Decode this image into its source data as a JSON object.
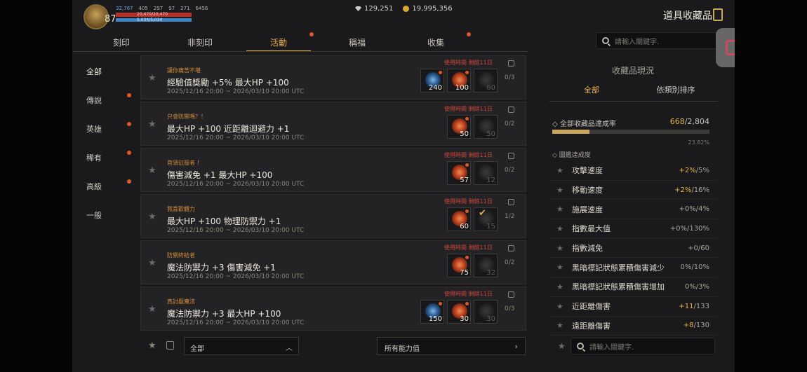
{
  "top": {
    "level": "87",
    "stats": [
      "32,767",
      "405",
      "297",
      "97",
      "271",
      "6456"
    ],
    "hp": "20,470/20,470",
    "mp": "5,034/5,034",
    "currency_gem": "129,251",
    "currency_gold": "19,995,356",
    "page_title": "道具收藏品"
  },
  "tabs": [
    {
      "label": "刻印",
      "active": false,
      "dot": false
    },
    {
      "label": "非刻印",
      "active": false,
      "dot": false
    },
    {
      "label": "活動",
      "active": true,
      "dot": true
    },
    {
      "label": "稱福",
      "active": false,
      "dot": false
    },
    {
      "label": "收集",
      "active": false,
      "dot": true
    }
  ],
  "search": {
    "placeholder": "請輸入關鍵字."
  },
  "categories": [
    {
      "label": "全部",
      "active": true,
      "dot": false
    },
    {
      "label": "傳說",
      "active": false,
      "dot": true
    },
    {
      "label": "英雄",
      "active": false,
      "dot": true
    },
    {
      "label": "稀有",
      "active": false,
      "dot": true
    },
    {
      "label": "高級",
      "active": false,
      "dot": true
    },
    {
      "label": "一般",
      "active": false,
      "dot": false
    }
  ],
  "list": {
    "time_label": "使用時間 剩餘11日",
    "date_range": "2025/12/16 20:00 ~ 2026/03/10 20:00 UTC",
    "rows": [
      {
        "name": "讓你痛苦不堪",
        "effect": "經驗值獎勵 +5% 最大HP +100",
        "count": "0/3",
        "slots": [
          {
            "color": "blue",
            "num": "240",
            "dim": false
          },
          {
            "color": "red",
            "num": "100",
            "dim": false
          },
          {
            "color": "gray",
            "num": "60",
            "dim": true
          }
        ]
      },
      {
        "name": "只會防禦嗎？！",
        "effect": "最大HP +100 近距離迴避力 +1",
        "count": "0/2",
        "slots": [
          {
            "color": "red",
            "num": "50",
            "dim": false
          },
          {
            "color": "gray",
            "num": "50",
            "dim": true
          }
        ]
      },
      {
        "name": "首領征服者 ！",
        "effect": "傷害減免 +1 最大HP +100",
        "count": "0/2",
        "slots": [
          {
            "color": "red",
            "num": "57",
            "dim": false
          },
          {
            "color": "gray",
            "num": "12",
            "dim": true
          }
        ]
      },
      {
        "name": "我喜歡體力",
        "effect": "最大HP +100 物理防禦力 +1",
        "count": "1/2",
        "slots": [
          {
            "color": "red",
            "num": "60",
            "dim": false
          },
          {
            "color": "gray",
            "num": "15",
            "dim": true,
            "checked": true
          }
        ]
      },
      {
        "name": "防禦終結者",
        "effect": "魔法防禦力 +3 傷害減免 +1",
        "count": "0/2",
        "slots": [
          {
            "color": "red",
            "num": "75",
            "dim": false
          },
          {
            "color": "gray",
            "num": "32",
            "dim": true
          }
        ]
      },
      {
        "name": "真討厭魔法",
        "effect": "魔法防禦力 +3 最大HP +100",
        "count": "0/3",
        "slots": [
          {
            "color": "blue",
            "num": "150",
            "dim": false
          },
          {
            "color": "red",
            "num": "30",
            "dim": false
          },
          {
            "color": "gray",
            "num": "30",
            "dim": true
          }
        ]
      }
    ]
  },
  "bottom": {
    "filter_all": "全部",
    "filter_ability": "所有能力值"
  },
  "panel": {
    "title": "收藏品現況",
    "tab_all": "全部",
    "tab_sort": "依類別排序",
    "rate_label": "全部收藏品達成率",
    "rate_current": "668",
    "rate_total": "/2,804",
    "rate_fraction": 0.2382,
    "rate_pct": "23.82%",
    "sub_label": "圖鑑達成度",
    "stats": [
      {
        "name": "攻擊速度",
        "cur": "+2%",
        "max": "/5%",
        "hi": true
      },
      {
        "name": "移動速度",
        "cur": "+2%",
        "max": "/16%",
        "hi": true
      },
      {
        "name": "施展速度",
        "cur": "+0%",
        "max": "/4%",
        "hi": false
      },
      {
        "name": "指數最大值",
        "cur": "+0%",
        "max": "/130%",
        "hi": false
      },
      {
        "name": "指數減免",
        "cur": "+0",
        "max": "/60",
        "hi": false
      },
      {
        "name": "黑暗標記狀態累積傷害減少",
        "cur": "0%",
        "max": "/10%",
        "hi": false
      },
      {
        "name": "黑暗標記狀態累積傷害增加",
        "cur": "0%",
        "max": "/3%",
        "hi": false
      },
      {
        "name": "近距離傷害",
        "cur": "+11",
        "max": "/133",
        "hi": true
      },
      {
        "name": "遠距離傷害",
        "cur": "+8",
        "max": "/130",
        "hi": true
      }
    ],
    "search_placeholder": "請輸入關鍵字."
  }
}
